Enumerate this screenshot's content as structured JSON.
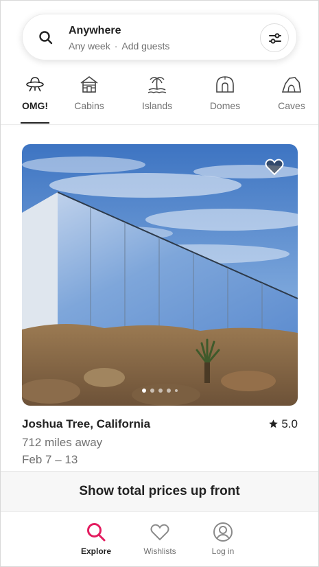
{
  "search": {
    "title": "Anywhere",
    "when": "Any week",
    "separator": "·",
    "who": "Add guests"
  },
  "categories": [
    {
      "label": "OMG!",
      "icon": "ufo-icon",
      "active": true
    },
    {
      "label": "Cabins",
      "icon": "cabin-icon",
      "active": false
    },
    {
      "label": "Islands",
      "icon": "palm-island-icon",
      "active": false
    },
    {
      "label": "Domes",
      "icon": "dome-icon",
      "active": false
    },
    {
      "label": "Caves",
      "icon": "cave-icon",
      "active": false
    }
  ],
  "listing": {
    "location": "Joshua Tree, California",
    "rating": "5.0",
    "distance": "712 miles away",
    "dates": "Feb 7 – 13",
    "photo_count": 5,
    "current_photo": 1
  },
  "price_banner": "Show total prices up front",
  "nav": [
    {
      "label": "Explore",
      "icon": "search-icon",
      "active": true
    },
    {
      "label": "Wishlists",
      "icon": "heart-icon",
      "active": false
    },
    {
      "label": "Log in",
      "icon": "user-icon",
      "active": false
    }
  ],
  "colors": {
    "accent": "#E31C5F",
    "text": "#222222",
    "muted": "#717171"
  }
}
